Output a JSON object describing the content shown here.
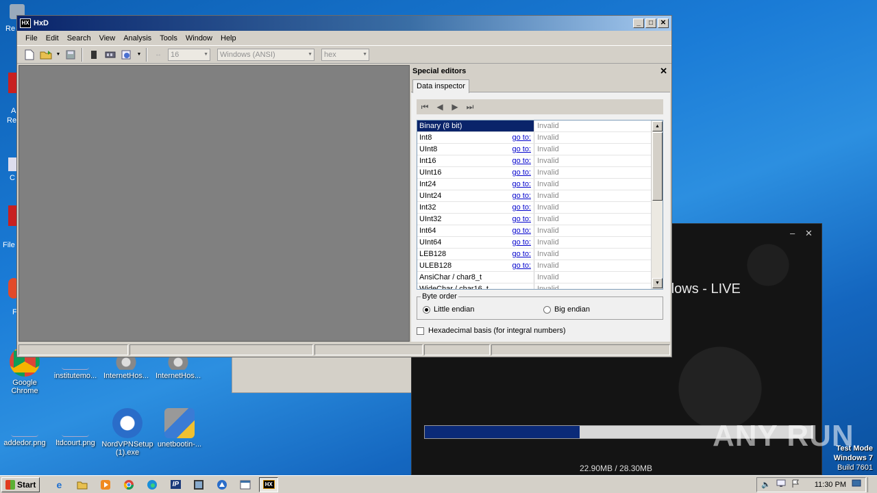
{
  "desktop": {
    "icons": [
      {
        "label": "Google Chrome"
      },
      {
        "label": "institutemo..."
      },
      {
        "label": "InternetHos..."
      },
      {
        "label": "InternetHos..."
      },
      {
        "label": "addedor.png"
      },
      {
        "label": "ltdcourt.png"
      },
      {
        "label": "NordVPNSetup (1).exe"
      },
      {
        "label": "unetbootin-..."
      }
    ],
    "partial_labels": [
      "Re",
      "A",
      "Re",
      "C",
      "File",
      "F"
    ]
  },
  "hxd": {
    "title": "HxD",
    "menu": [
      "File",
      "Edit",
      "Search",
      "View",
      "Analysis",
      "Tools",
      "Window",
      "Help"
    ],
    "toolbar": {
      "bytes_per_row": "16",
      "charset": "Windows (ANSI)",
      "offset_base": "hex"
    },
    "special_editors": {
      "title": "Special editors",
      "tab": "Data inspector",
      "go_to_label": "go to:",
      "rows": [
        {
          "type": "Binary (8 bit)",
          "value": "Invalid",
          "goto": false
        },
        {
          "type": "Int8",
          "value": "Invalid",
          "goto": true
        },
        {
          "type": "UInt8",
          "value": "Invalid",
          "goto": true
        },
        {
          "type": "Int16",
          "value": "Invalid",
          "goto": true
        },
        {
          "type": "UInt16",
          "value": "Invalid",
          "goto": true
        },
        {
          "type": "Int24",
          "value": "Invalid",
          "goto": true
        },
        {
          "type": "UInt24",
          "value": "Invalid",
          "goto": true
        },
        {
          "type": "Int32",
          "value": "Invalid",
          "goto": true
        },
        {
          "type": "UInt32",
          "value": "Invalid",
          "goto": true
        },
        {
          "type": "Int64",
          "value": "Invalid",
          "goto": true
        },
        {
          "type": "UInt64",
          "value": "Invalid",
          "goto": true
        },
        {
          "type": "LEB128",
          "value": "Invalid",
          "goto": true
        },
        {
          "type": "ULEB128",
          "value": "Invalid",
          "goto": true
        },
        {
          "type": "AnsiChar / char8_t",
          "value": "Invalid",
          "goto": false
        },
        {
          "type": "WideChar / char16_t",
          "value": "Invalid",
          "goto": false
        }
      ],
      "byte_order": {
        "legend": "Byte order",
        "little": "Little endian",
        "big": "Big endian",
        "selected": "little"
      },
      "hex_basis_label": "Hexadecimal basis (for integral numbers)"
    }
  },
  "live_window": {
    "title_partial": "dows - LIVE",
    "progress": 0.4,
    "size_text": "22.90MB / 28.30MB"
  },
  "watermark": "ANY RUN",
  "test_mode": {
    "line1": "Test Mode",
    "line2": "Windows 7",
    "line3": "Build 7601"
  },
  "taskbar": {
    "start_label": "Start",
    "clock": "11:30 PM"
  },
  "colors": {
    "hxd_title_start": "#0a246a",
    "selection": "#0a246a",
    "progress_fill": "#0b2a78",
    "link": "#0000cc"
  }
}
